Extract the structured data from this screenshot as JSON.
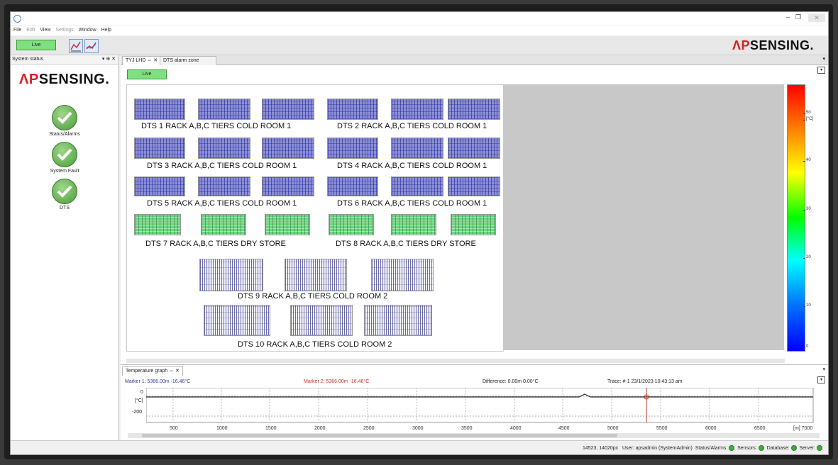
{
  "menu": [
    "File",
    "Edit",
    "View",
    "Settings",
    "Window",
    "Help"
  ],
  "toolbar": {
    "live_label": "Live"
  },
  "brand": {
    "prefix": "ΛP",
    "suffix": "SENSING."
  },
  "system_status": {
    "title": "System status",
    "items": [
      {
        "label": "Status/Alarms"
      },
      {
        "label": "System Fault"
      },
      {
        "label": "DTS"
      }
    ]
  },
  "tabs": {
    "tab1": "TYJ LHD",
    "tab2": "DTS alarm zone"
  },
  "doc": {
    "live_label": "Live",
    "zones": [
      "DTS 1 RACK A,B,C TIERS COLD ROOM 1",
      "DTS 2 RACK A,B,C TIERS COLD ROOM 1",
      "DTS 3 RACK A,B,C TIERS COLD ROOM 1",
      "DTS 4 RACK A,B,C TIERS COLD ROOM 1",
      "DTS 5 RACK A,B,C TIERS COLD ROOM 1",
      "DTS 6 RACK A,B,C TIERS COLD ROOM 1",
      "DTS 7 RACK A,B,C TIERS DRY STORE",
      "DTS 8 RACK A,B,C TIERS DRY STORE",
      "DTS 9  RACK A,B,C TIERS COLD ROOM 2",
      "DTS 10 RACK A,B,C TIERS COLD ROOM 2"
    ]
  },
  "colorbar": {
    "unit": "[°C]",
    "ticks": [
      "50",
      "40",
      "30",
      "20",
      "10",
      "0"
    ]
  },
  "graph": {
    "title": "Temperature graph",
    "marker1": "Marker 1: 5366.00m -16.46°C",
    "marker2": "Marker 2: 5366.00m -16.46°C",
    "difference": "Difference: 0.00m 0.00°C",
    "trace": "Trace: #-1 23/1/2023 10:43:13 am",
    "y_ticks": [
      "0",
      "[°C]",
      "-200"
    ],
    "x_ticks": [
      "500",
      "1000",
      "1500",
      "2000",
      "2500",
      "3000",
      "3500",
      "4000",
      "4500",
      "5000",
      "5500",
      "6000",
      "6500"
    ],
    "x_last": "[m]  7000"
  },
  "statusbar": {
    "coords": "14523, 14020px",
    "user": "User: apsadmin (SystemAdmin)",
    "status_alarms": "Status/Alarms:",
    "sensors": "Sensors:",
    "database": "Database:",
    "server": "Server:"
  },
  "colors": {
    "live": "#7fe07f",
    "brand_red": "#e01a22",
    "ok": "#3fae3f"
  }
}
